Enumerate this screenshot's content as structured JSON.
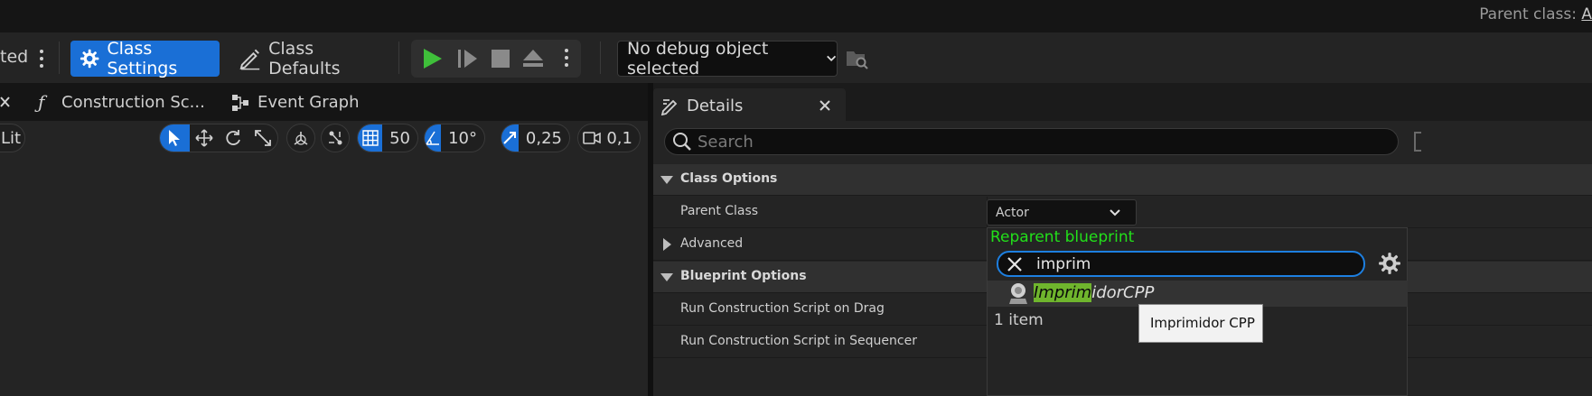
{
  "header": {
    "parent_class_label": "Parent class:",
    "parent_class_value": "A"
  },
  "toolbar": {
    "cut_text": "ted",
    "class_settings_label": "Class Settings",
    "class_defaults_label": "Class Defaults",
    "debug_label": "No debug object selected"
  },
  "tabs": {
    "construction_label": "Construction Sc...",
    "event_graph_label": "Event Graph"
  },
  "viewport": {
    "lit_label": "Lit",
    "grid_size": "50",
    "rotation_snap": "10°",
    "scale_snap": "0,25",
    "camera_speed": "0,1"
  },
  "details": {
    "tab_label": "Details",
    "search_placeholder": "Search",
    "class_options_label": "Class Options",
    "parent_class_label": "Parent Class",
    "parent_class_value": "Actor",
    "advanced_label": "Advanced",
    "blueprint_options_label": "Blueprint Options",
    "run_on_drag_label": "Run Construction Script on Drag",
    "run_in_sequencer_label": "Run Construction Script in Sequencer"
  },
  "reparent": {
    "title": "Reparent blueprint",
    "search_value": "imprim",
    "result_match": "Imprim",
    "result_rest": "idorCPP",
    "item_count": "1 item",
    "tooltip": "Imprimidor CPP"
  },
  "colors": {
    "accent": "#1a6fd6",
    "play": "#3fbf3a",
    "highlight": "#6fb52d",
    "popup_title": "#22e01a"
  }
}
